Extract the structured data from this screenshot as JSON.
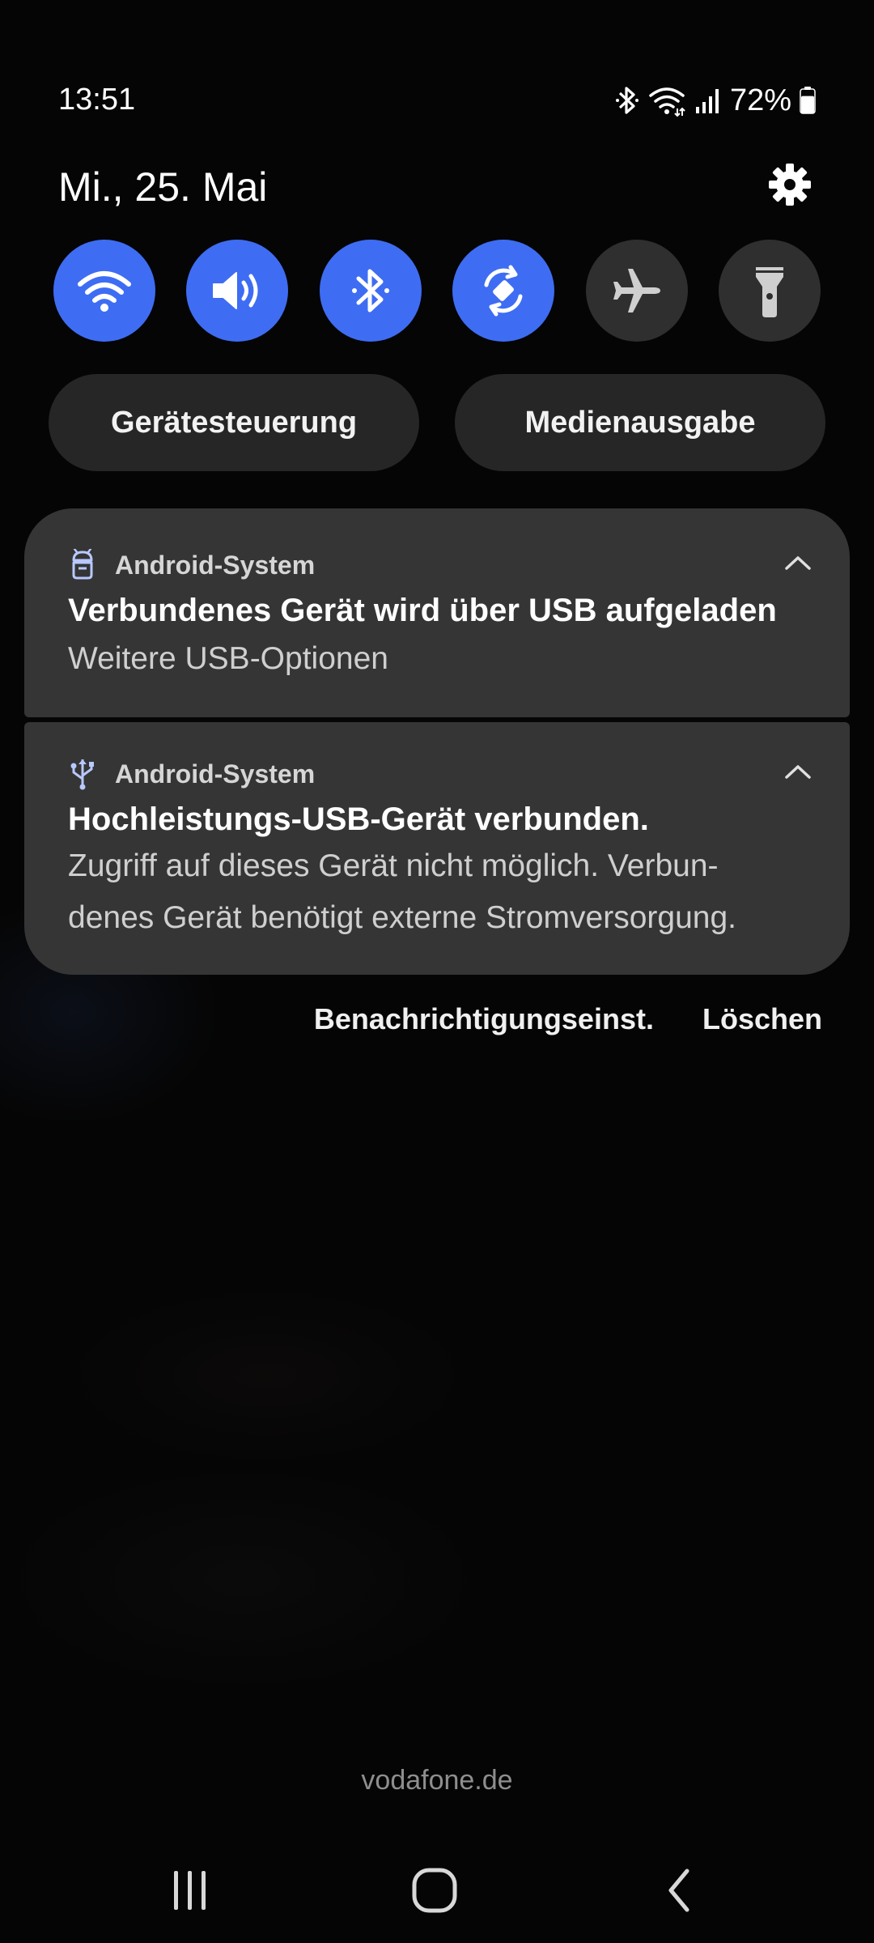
{
  "status_bar": {
    "time": "13:51",
    "battery_percent": "72%",
    "battery_level": 0.72,
    "icons": [
      "bluetooth-icon",
      "wifi-icon",
      "signal-icon",
      "battery-icon"
    ]
  },
  "header": {
    "date": "Mi., 25. Mai",
    "settings_icon": "gear-icon"
  },
  "quick_toggles": [
    {
      "name": "wifi",
      "icon": "wifi-icon",
      "active": true
    },
    {
      "name": "sound",
      "icon": "speaker-icon",
      "active": true
    },
    {
      "name": "bluetooth",
      "icon": "bluetooth-icon",
      "active": true
    },
    {
      "name": "auto-rotate",
      "icon": "rotate-icon",
      "active": true
    },
    {
      "name": "airplane",
      "icon": "airplane-icon",
      "active": false
    },
    {
      "name": "flashlight",
      "icon": "flashlight-icon",
      "active": false
    }
  ],
  "pills": {
    "device_control": "Gerätesteuerung",
    "media_output": "Medienausgabe"
  },
  "notifications": [
    {
      "app": "Android-System",
      "icon": "robot-icon",
      "title": "Verbundenes Gerät wird über USB aufgeladen",
      "body": "Weitere USB-Optionen"
    },
    {
      "app": "Android-System",
      "icon": "usb-icon",
      "title": "Hochleistungs-USB-Gerät verbunden.",
      "body_line1": "Zugriff auf dieses Gerät nicht möglich. Verbun-",
      "body_line2": "denes Gerät benötigt externe Stromversorgung."
    }
  ],
  "actions": {
    "notification_settings": "Benachrichtigungseinst.",
    "clear": "Löschen"
  },
  "carrier": "vodafone.de",
  "colors": {
    "accent": "#3e6df3",
    "toggle_off": "#2f2f2f",
    "card": "#353535",
    "pill": "#262626"
  }
}
